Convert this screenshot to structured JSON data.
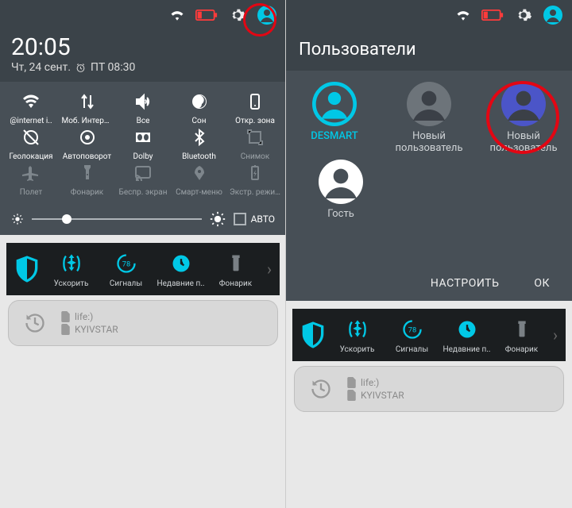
{
  "left": {
    "clock": "20:05",
    "date": "Чт, 24 сент.",
    "alarm": "ПТ 08:30",
    "tiles": [
      {
        "id": "wifi",
        "label": "@internet i..",
        "dim": false
      },
      {
        "id": "mobile-data",
        "label": "Моб. Интернет",
        "dim": false
      },
      {
        "id": "volume",
        "label": "Все",
        "dim": false
      },
      {
        "id": "dnd",
        "label": "Сон",
        "dim": false
      },
      {
        "id": "hotspot",
        "label": "Откр. зона",
        "dim": false
      },
      {
        "id": "location",
        "label": "Геолокация",
        "dim": false
      },
      {
        "id": "rotation",
        "label": "Автоповорот",
        "dim": false
      },
      {
        "id": "dolby",
        "label": "Dolby",
        "dim": false
      },
      {
        "id": "bluetooth",
        "label": "Bluetooth",
        "dim": false
      },
      {
        "id": "screenshot",
        "label": "Снимок",
        "dim": true
      },
      {
        "id": "airplane",
        "label": "Полет",
        "dim": true
      },
      {
        "id": "flashlight",
        "label": "Фонарик",
        "dim": true
      },
      {
        "id": "cast",
        "label": "Беспр. экран",
        "dim": true
      },
      {
        "id": "smart",
        "label": "Смарт-меню",
        "dim": true
      },
      {
        "id": "battery-saver",
        "label": "Экстр. режим",
        "dim": true
      }
    ],
    "auto_label": "АВТО"
  },
  "dock": [
    {
      "id": "boost",
      "label": "Ускорить"
    },
    {
      "id": "alarms",
      "label": "Сигналы"
    },
    {
      "id": "recent",
      "label": "Недавние п.."
    },
    {
      "id": "torch",
      "label": "Фонарик"
    }
  ],
  "sim": {
    "a": "life:)",
    "b": "KYIVSTAR"
  },
  "right": {
    "title": "Пользователи",
    "users": [
      {
        "id": "desmart",
        "label": "DESMART",
        "active": true,
        "color": "#00c8e6"
      },
      {
        "id": "new1",
        "label": "Новый\nпользователь",
        "color": "#6d747a"
      },
      {
        "id": "new2",
        "label": "Новый\nпользователь",
        "color": "#4b55c8"
      },
      {
        "id": "guest",
        "label": "Гость",
        "color": "#ffffff"
      }
    ],
    "btn_setup": "НАСТРОИТЬ",
    "btn_ok": "ОК"
  },
  "colors": {
    "accent": "#00c8e6",
    "panel": "#474f56",
    "top": "#3b4349"
  }
}
